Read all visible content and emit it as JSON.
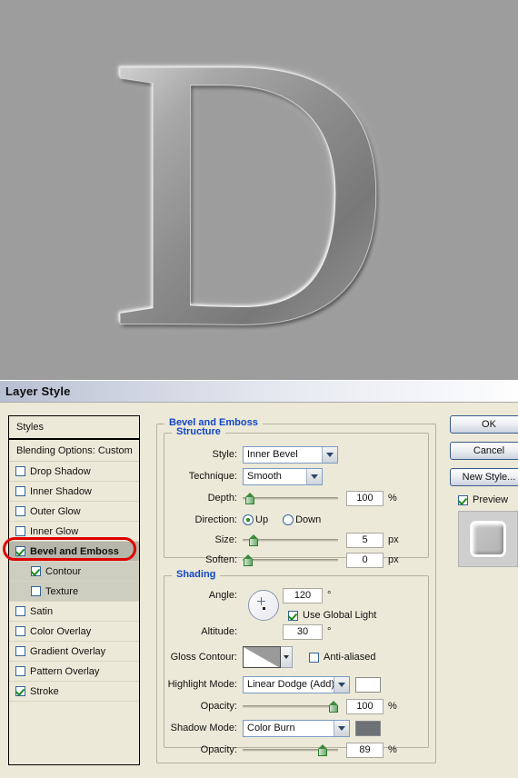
{
  "canvas": {
    "letter": "D",
    "background_color": "#9d9d9d"
  },
  "dialog": {
    "title": "Layer Style"
  },
  "styles_panel": {
    "header": "Styles",
    "blending_options": "Blending Options: Custom",
    "effects": [
      {
        "label": "Drop Shadow",
        "checked": false,
        "sub": false,
        "selected": false
      },
      {
        "label": "Inner Shadow",
        "checked": false,
        "sub": false,
        "selected": false
      },
      {
        "label": "Outer Glow",
        "checked": false,
        "sub": false,
        "selected": false
      },
      {
        "label": "Inner Glow",
        "checked": false,
        "sub": false,
        "selected": false
      },
      {
        "label": "Bevel and Emboss",
        "checked": true,
        "sub": false,
        "selected": true
      },
      {
        "label": "Contour",
        "checked": true,
        "sub": true,
        "selected": false
      },
      {
        "label": "Texture",
        "checked": false,
        "sub": true,
        "selected": false
      },
      {
        "label": "Satin",
        "checked": false,
        "sub": false,
        "selected": false
      },
      {
        "label": "Color Overlay",
        "checked": false,
        "sub": false,
        "selected": false
      },
      {
        "label": "Gradient Overlay",
        "checked": false,
        "sub": false,
        "selected": false
      },
      {
        "label": "Pattern Overlay",
        "checked": false,
        "sub": false,
        "selected": false
      },
      {
        "label": "Stroke",
        "checked": true,
        "sub": false,
        "selected": false
      }
    ],
    "highlight_color": "#e00000"
  },
  "bevel": {
    "group_title": "Bevel and Emboss",
    "structure": {
      "title": "Structure",
      "style_label": "Style:",
      "style_value": "Inner Bevel",
      "technique_label": "Technique:",
      "technique_value": "Smooth",
      "depth_label": "Depth:",
      "depth_value": "100",
      "depth_unit": "%",
      "direction_label": "Direction:",
      "direction_up": "Up",
      "direction_down": "Down",
      "direction_selected": "Up",
      "size_label": "Size:",
      "size_value": "5",
      "size_unit": "px",
      "soften_label": "Soften:",
      "soften_value": "0",
      "soften_unit": "px"
    },
    "shading": {
      "title": "Shading",
      "angle_label": "Angle:",
      "angle_value": "120",
      "angle_unit": "°",
      "use_global_light": "Use Global Light",
      "use_global_light_checked": true,
      "altitude_label": "Altitude:",
      "altitude_value": "30",
      "altitude_unit": "°",
      "gloss_contour_label": "Gloss Contour:",
      "anti_aliased": "Anti-aliased",
      "anti_aliased_checked": false,
      "highlight_mode_label": "Highlight Mode:",
      "highlight_mode_value": "Linear Dodge (Add)",
      "highlight_color": "#ffffff",
      "highlight_opacity_label": "Opacity:",
      "highlight_opacity_value": "100",
      "highlight_opacity_unit": "%",
      "shadow_mode_label": "Shadow Mode:",
      "shadow_mode_value": "Color Burn",
      "shadow_color": "#6e7175",
      "shadow_opacity_label": "Opacity:",
      "shadow_opacity_value": "89",
      "shadow_opacity_unit": "%"
    }
  },
  "buttons": {
    "ok": "OK",
    "cancel": "Cancel",
    "new_style": "New Style...",
    "preview": "Preview",
    "preview_checked": true
  }
}
